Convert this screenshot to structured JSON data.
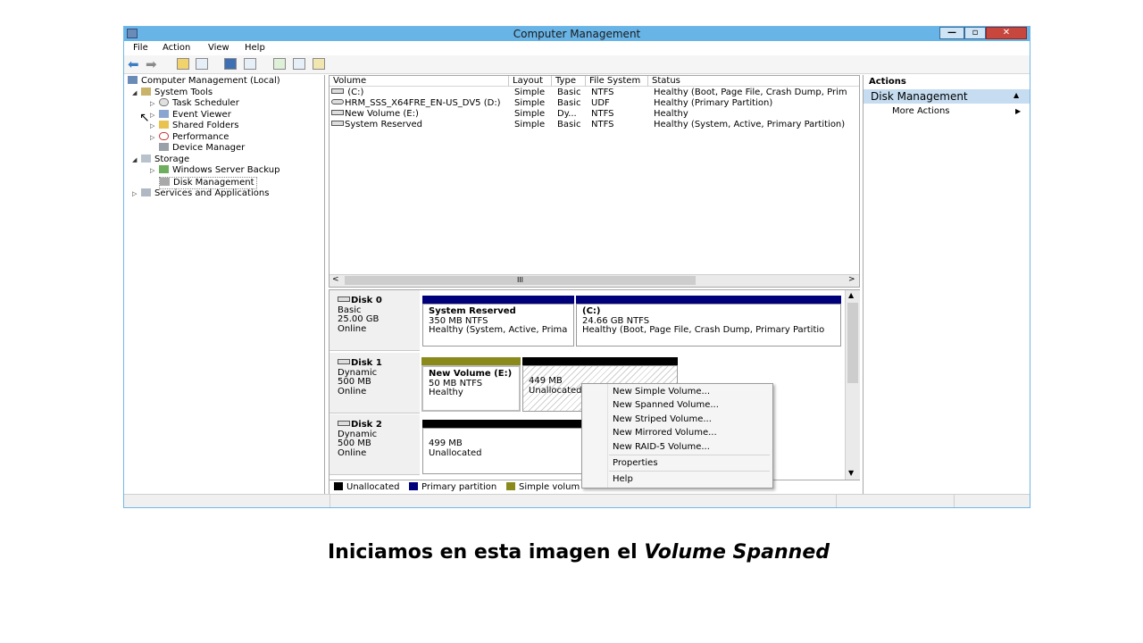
{
  "window": {
    "title": "Computer Management",
    "min_glyph": "—",
    "max_glyph": "▫",
    "close_glyph": "✕"
  },
  "menu": [
    "File",
    "Action",
    "View",
    "Help"
  ],
  "tree": {
    "root": "Computer Management (Local)",
    "system_tools": "System Tools",
    "task_scheduler": "Task Scheduler",
    "event_viewer": "Event Viewer",
    "shared_folders": "Shared Folders",
    "performance": "Performance",
    "device_manager": "Device Manager",
    "storage": "Storage",
    "windows_server_backup": "Windows Server Backup",
    "disk_management": "Disk Management",
    "services": "Services and Applications"
  },
  "volume_list": {
    "columns": [
      "Volume",
      "Layout",
      "Type",
      "File System",
      "Status"
    ],
    "rows": [
      {
        "volume": "(C:)",
        "layout": "Simple",
        "type": "Basic",
        "fs": "NTFS",
        "status": "Healthy (Boot, Page File, Crash Dump, Prim"
      },
      {
        "volume": "HRM_SSS_X64FRE_EN-US_DV5 (D:)",
        "layout": "Simple",
        "type": "Basic",
        "fs": "UDF",
        "status": "Healthy (Primary Partition)"
      },
      {
        "volume": "New Volume (E:)",
        "layout": "Simple",
        "type": "Dy...",
        "fs": "NTFS",
        "status": "Healthy"
      },
      {
        "volume": "System Reserved",
        "layout": "Simple",
        "type": "Basic",
        "fs": "NTFS",
        "status": "Healthy (System, Active, Primary Partition)"
      }
    ],
    "scroll_grip": "III"
  },
  "disks": [
    {
      "name": "Disk 0",
      "kind": "Basic",
      "size": "25.00 GB",
      "state": "Online",
      "parts": [
        {
          "title": "System Reserved",
          "line2": "350 MB NTFS",
          "line3": "Healthy (System, Active, Prima"
        },
        {
          "title": "(C:)",
          "line2": "24.66 GB NTFS",
          "line3": "Healthy (Boot, Page File, Crash Dump, Primary Partitio"
        }
      ]
    },
    {
      "name": "Disk 1",
      "kind": "Dynamic",
      "size": "500 MB",
      "state": "Online",
      "parts": [
        {
          "title": "New Volume  (E:)",
          "line2": "50 MB NTFS",
          "line3": "Healthy"
        },
        {
          "title": "",
          "line2": "449 MB",
          "line3": "Unallocated"
        }
      ]
    },
    {
      "name": "Disk 2",
      "kind": "Dynamic",
      "size": "500 MB",
      "state": "Online",
      "parts": [
        {
          "title": "",
          "line2": "499 MB",
          "line3": "Unallocated"
        }
      ]
    }
  ],
  "legend": [
    "Unallocated",
    "Primary partition",
    "Simple volum"
  ],
  "colors": {
    "unallocated": "#000000",
    "primary": "#00007b",
    "simple": "#8a8a1c",
    "titlebar": "#69b4e6",
    "actions_header": "#c6dcf0"
  },
  "actions": {
    "header": "Actions",
    "section": "Disk Management",
    "section_glyph": "▲",
    "more": "More Actions",
    "more_glyph": "▶"
  },
  "context_menu": [
    "New Simple Volume...",
    "New Spanned Volume...",
    "New Striped Volume...",
    "New Mirrored Volume...",
    "New RAID-5 Volume...",
    "Properties",
    "Help"
  ],
  "caption": {
    "prefix": "Iniciamos en esta imagen el ",
    "emphasis": "Volume Spanned"
  }
}
